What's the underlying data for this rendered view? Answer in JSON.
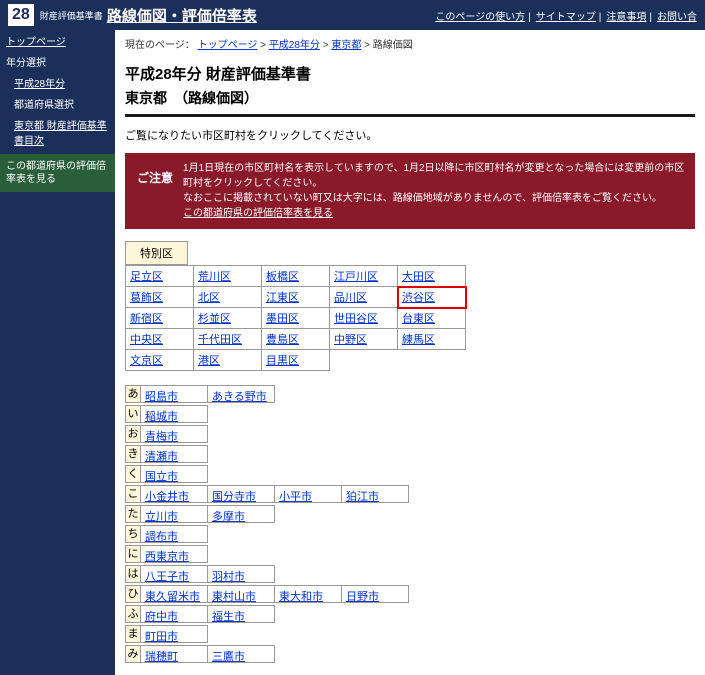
{
  "header": {
    "logo": "28",
    "sub": "財産評価基準書",
    "title": "路線価図・評価倍率表",
    "links": [
      "このページの使い方",
      "サイトマップ",
      "注意事項",
      "お問い合"
    ]
  },
  "sidebar": {
    "top": "トップページ",
    "yearSelect": "年分選択",
    "yearLink": "平成28年分",
    "prefSelect": "都道府県選択",
    "tocLink": "東京都 財産評価基準書目次",
    "banner": "この都道府県の評価倍率表を見る"
  },
  "breadcrumb": {
    "label": "現在のページ：",
    "items": [
      "トップページ",
      "平成28年分",
      "東京都"
    ],
    "current": "路線価図"
  },
  "page": {
    "title": "平成28年分 財産評価基準書",
    "subtitle": "東京都　（路線価図）",
    "instruction": "ご覧になりたい市区町村をクリックしてください。"
  },
  "notice": {
    "label": "ご注意",
    "line1": "1月1日現在の市区町村名を表示していますので、1月2日以降に市区町村名が変更となった場合には変更前の市区町村をクリックしてください。",
    "line2": "なおここに掲載されていない町又は大字には、路線価地域がありませんので、評価倍率表をご覧ください。",
    "link": "この都道府県の評価倍率表を見る"
  },
  "wards": {
    "header": "特別区",
    "rows": [
      [
        "足立区",
        "荒川区",
        "板橋区",
        "江戸川区",
        "大田区"
      ],
      [
        "葛飾区",
        "北区",
        "江東区",
        "品川区",
        "渋谷区"
      ],
      [
        "新宿区",
        "杉並区",
        "墨田区",
        "世田谷区",
        "台東区"
      ],
      [
        "中央区",
        "千代田区",
        "豊島区",
        "中野区",
        "練馬区"
      ],
      [
        "文京区",
        "港区",
        "目黒区",
        "",
        ""
      ]
    ],
    "highlight": [
      1,
      4
    ]
  },
  "cities": [
    {
      "idx": "あ",
      "items": [
        "昭島市",
        "あきる野市"
      ]
    },
    {
      "idx": "い",
      "items": [
        "稲城市"
      ]
    },
    {
      "idx": "お",
      "items": [
        "青梅市"
      ]
    },
    {
      "idx": "き",
      "items": [
        "清瀬市"
      ]
    },
    {
      "idx": "く",
      "items": [
        "国立市"
      ]
    },
    {
      "idx": "こ",
      "items": [
        "小金井市",
        "国分寺市",
        "小平市",
        "狛江市"
      ]
    },
    {
      "idx": "た",
      "items": [
        "立川市",
        "多摩市"
      ]
    },
    {
      "idx": "ち",
      "items": [
        "調布市"
      ]
    },
    {
      "idx": "に",
      "items": [
        "西東京市"
      ]
    },
    {
      "idx": "は",
      "items": [
        "八王子市",
        "羽村市"
      ]
    },
    {
      "idx": "ひ",
      "items": [
        "東久留米市",
        "東村山市",
        "東大和市",
        "日野市"
      ]
    },
    {
      "idx": "ふ",
      "items": [
        "府中市",
        "福生市"
      ]
    },
    {
      "idx": "ま",
      "items": [
        "町田市"
      ]
    },
    {
      "idx": "み",
      "items": [
        "瑞穂町",
        "三鷹市"
      ]
    }
  ]
}
